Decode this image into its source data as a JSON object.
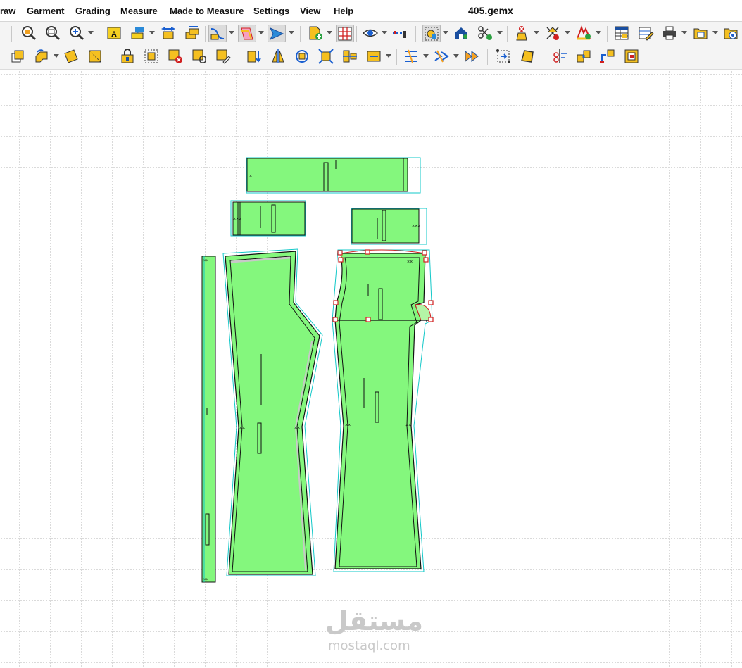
{
  "menu": {
    "items": [
      "raw",
      "Garment",
      "Grading",
      "Measure",
      "Made to Measure",
      "Settings",
      "View",
      "Help"
    ]
  },
  "window": {
    "title": "405.gemx"
  },
  "toolbar1": {
    "icons": [
      "zoom-window-icon",
      "zoom-fit-icon",
      "zoom-in-icon",
      "text-label-icon",
      "annotation-icon",
      "move-piece-icon",
      "stack-pieces-icon",
      "curve-tool-icon",
      "contour-tool-icon",
      "arrow-tool-icon",
      "add-piece-icon",
      "grid-icon",
      "visibility-icon",
      "measure-line-icon",
      "select-piece-icon",
      "house-tool-icon",
      "scissors-check-icon",
      "person-delete-icon",
      "cut-delete-icon",
      "grade-check-icon",
      "table-icon",
      "edit-table-icon",
      "print-icon",
      "folder-save-icon",
      "preview-icon"
    ]
  },
  "toolbar2": {
    "icons": [
      "copy-piece-icon",
      "rotate-piece-icon",
      "yellow-square-icon",
      "yellow-diamond-icon",
      "lock-piece-icon",
      "select-box-icon",
      "delete-piece-icon",
      "link-piece-icon",
      "edit-piece-icon",
      "align-down-icon",
      "mirror-piece-icon",
      "rotate-cw-icon",
      "fit-box-icon",
      "align-horizontal-icon",
      "marker-icon",
      "split-arrows-icon",
      "merge-arrows-icon",
      "fast-forward-icon",
      "expand-points-icon",
      "yellow-shape-icon",
      "scissors-measure-icon",
      "join-pieces-icon",
      "move-point-icon",
      "frame-tool-icon"
    ]
  },
  "colors": {
    "piece_fill": "#84f77d",
    "piece_stroke": "#111111",
    "seam_line": "#12c8c8",
    "selection": "#e02020",
    "grid": "#b4b4b4"
  },
  "watermark": {
    "arabic": "مستقل",
    "latin": "mostaql.com"
  }
}
